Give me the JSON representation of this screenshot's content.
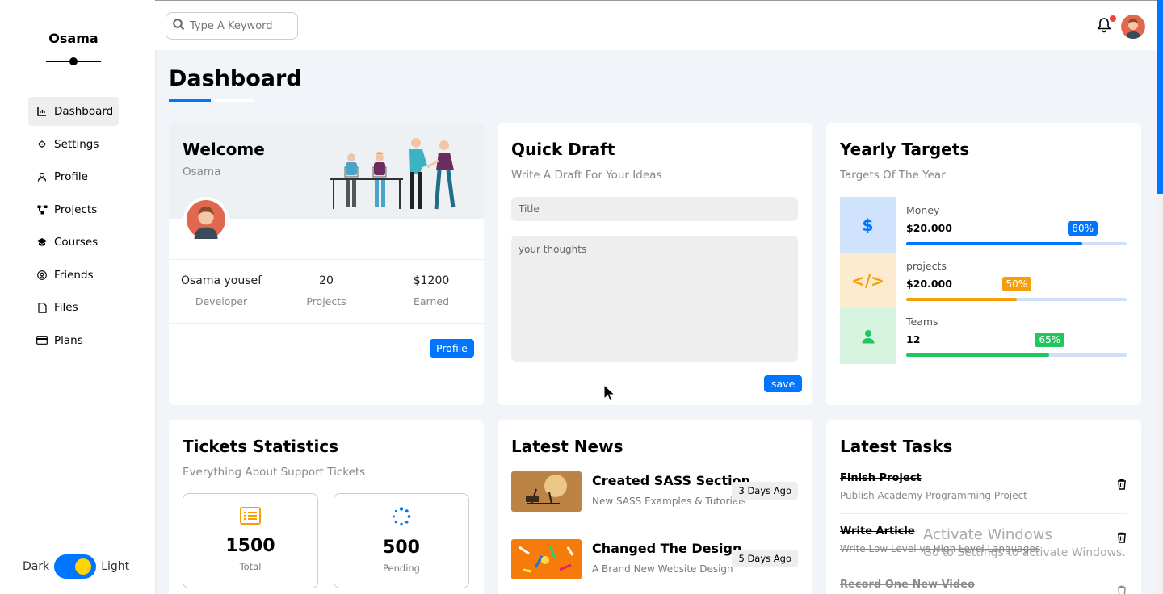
{
  "sidebar": {
    "brand": "Osama",
    "items": [
      {
        "label": "Dashboard",
        "icon": "chart-icon",
        "active": true
      },
      {
        "label": "Settings",
        "icon": "gear-icon"
      },
      {
        "label": "Profile",
        "icon": "user-icon"
      },
      {
        "label": "Projects",
        "icon": "diagram-icon"
      },
      {
        "label": "Courses",
        "icon": "graduation-cap-icon"
      },
      {
        "label": "Friends",
        "icon": "user-circle-icon"
      },
      {
        "label": "Files",
        "icon": "file-icon"
      },
      {
        "label": "Plans",
        "icon": "credit-card-icon"
      }
    ],
    "theme": {
      "dark_label": "Dark",
      "light_label": "Light"
    }
  },
  "header": {
    "search_placeholder": "Type A Keyword"
  },
  "page": {
    "title": "Dashboard"
  },
  "welcome": {
    "title": "Welcome",
    "name": "Osama",
    "stats": [
      {
        "value": "Osama yousef",
        "label": "Developer"
      },
      {
        "value": "20",
        "label": "Projects"
      },
      {
        "value": "$1200",
        "label": "Earned"
      }
    ],
    "button": "Profile"
  },
  "draft": {
    "title": "Quick Draft",
    "subtitle": "Write A Draft For Your Ideas",
    "title_placeholder": "Title",
    "body_placeholder": "your thoughts",
    "button": "save"
  },
  "targets": {
    "title": "Yearly Targets",
    "subtitle": "Targets Of The Year",
    "items": [
      {
        "label": "Money",
        "value": "$20.000",
        "percent": 80,
        "badge": "80%",
        "icon": "dollar-icon",
        "color": "#0075ff",
        "bg": "#cfe4fc"
      },
      {
        "label": "projects",
        "value": "$20.000",
        "percent": 50,
        "badge": "50%",
        "icon": "code-icon",
        "color": "#f59e0b",
        "bg": "#fdebd0"
      },
      {
        "label": "Teams",
        "value": "12",
        "percent": 65,
        "badge": "65%",
        "icon": "user-icon",
        "color": "#22c55e",
        "bg": "#d6f3e0"
      }
    ]
  },
  "tickets": {
    "title": "Tickets Statistics",
    "subtitle": "Everything About Support Tickets",
    "boxes": [
      {
        "value": "1500",
        "label": "Total",
        "icon": "list-icon",
        "color": "#f59e0b"
      },
      {
        "value": "500",
        "label": "Pending",
        "icon": "spinner-icon",
        "color": "#0075ff"
      }
    ]
  },
  "news": {
    "title": "Latest News",
    "items": [
      {
        "title": "Created SASS Section",
        "desc": "New SASS Examples & Tutorials",
        "date": "3 Days Ago"
      },
      {
        "title": "Changed The Design",
        "desc": "A Brand New Website Design",
        "date": "5 Days Ago"
      }
    ]
  },
  "tasks": {
    "title": "Latest Tasks",
    "items": [
      {
        "title": "Finish Project",
        "desc": "Publish Academy Programming Project"
      },
      {
        "title": "Write Article",
        "desc": "Write Low Level vs High Level Languages"
      },
      {
        "title": "Record One New Video",
        "desc": ""
      }
    ]
  },
  "watermark": {
    "line1": "Activate Windows",
    "line2": "Go to Settings to activate Windows."
  },
  "colors": {
    "accent": "#0075ff",
    "background": "#f1f5f9"
  }
}
